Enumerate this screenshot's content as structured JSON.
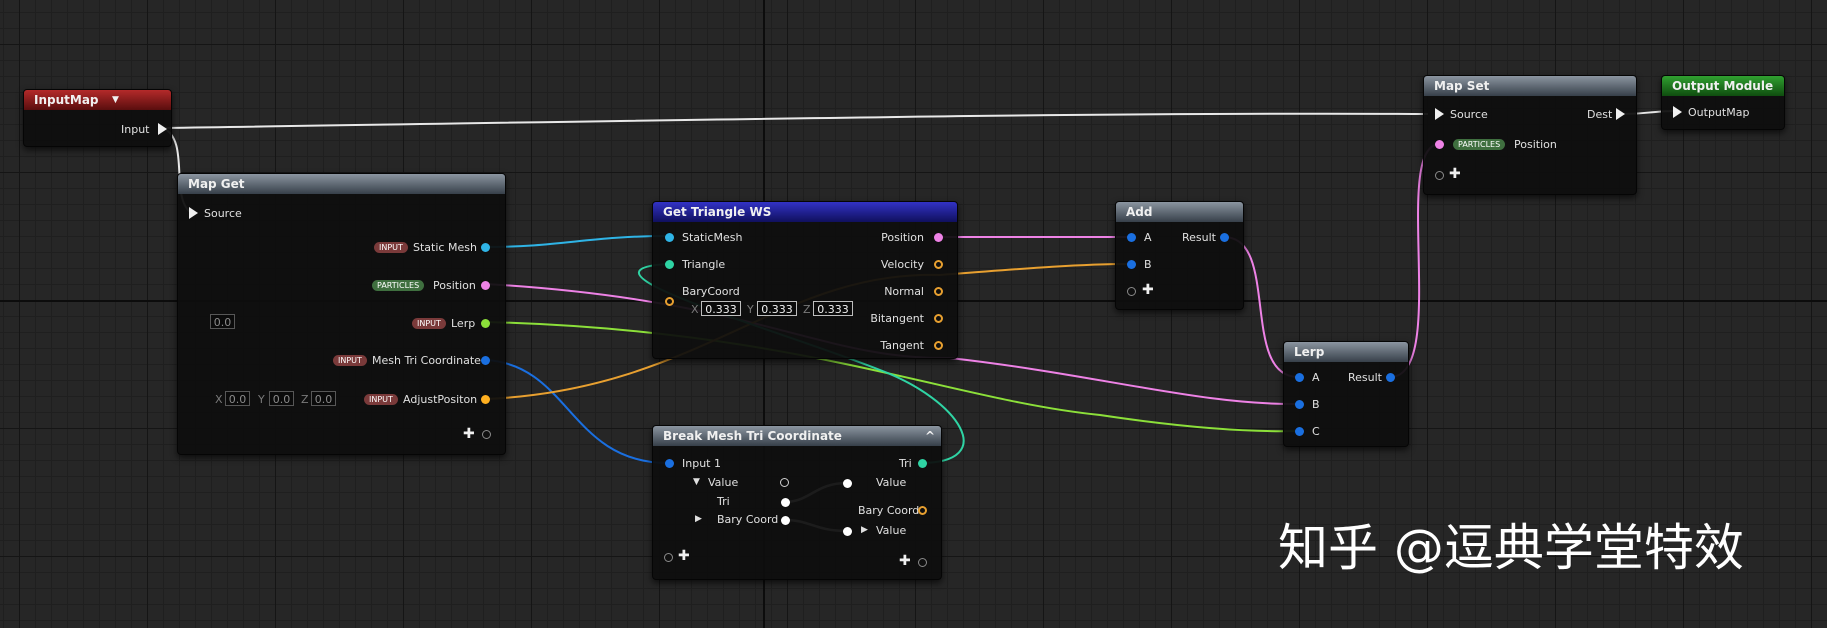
{
  "nodes": {
    "input_map": {
      "title": "InputMap",
      "pin_input": "Input"
    },
    "map_get": {
      "title": "Map Get",
      "source": "Source",
      "badge_input": "INPUT",
      "badge_particles": "PARTICLES",
      "static_mesh": "Static Mesh",
      "position": "Position",
      "lerp": "Lerp",
      "mesh_tri_coordinate": "Mesh Tri Coordinate",
      "adjust_position": "AdjustPositon",
      "lerp_default": "0.0",
      "vec_x_label": "X",
      "vec_x": "0.0",
      "vec_y_label": "Y",
      "vec_y": "0.0",
      "vec_z_label": "Z",
      "vec_z": "0.0"
    },
    "get_triangle": {
      "title": "Get Triangle WS",
      "static_mesh": "StaticMesh",
      "triangle": "Triangle",
      "bary_coord": "BaryCoord",
      "x_label": "X",
      "x": "0.333",
      "y_label": "Y",
      "y": "0.333",
      "z_label": "Z",
      "z": "0.333",
      "out_position": "Position",
      "out_velocity": "Velocity",
      "out_normal": "Normal",
      "out_bitangent": "Bitangent",
      "out_tangent": "Tangent"
    },
    "break_mesh": {
      "title": "Break Mesh Tri Coordinate",
      "input1": "Input 1",
      "value": "Value",
      "tri": "Tri",
      "bary_coord": "Bary Coord",
      "out_tri": "Tri",
      "out_value1": "Value",
      "out_bary_coord": "Bary Coord",
      "out_value2": "Value"
    },
    "add": {
      "title": "Add",
      "a": "A",
      "b": "B",
      "result": "Result"
    },
    "lerp": {
      "title": "Lerp",
      "a": "A",
      "b": "B",
      "c": "C",
      "result": "Result"
    },
    "map_set": {
      "title": "Map Set",
      "source": "Source",
      "dest": "Dest",
      "badge_particles": "PARTICLES",
      "position": "Position"
    },
    "output_module": {
      "title": "Output Module",
      "output_map": "OutputMap"
    }
  },
  "watermark": "知乎 @逗典学堂特效",
  "colors": {
    "pin_blue": "#1a6fe0",
    "pin_cyan": "#2fb4e6",
    "pin_teal": "#2fd4a4",
    "pin_pink": "#ee82e6",
    "pin_yellowgreen": "#8ce03a",
    "pin_orange": "#ffb020",
    "wire_exec": "#e8e8e8"
  },
  "icons": [
    "play-exec-icon",
    "plus-icon",
    "collapse-chevron-icon",
    "expand-triangle-icon",
    "dropdown-arrow-icon"
  ]
}
